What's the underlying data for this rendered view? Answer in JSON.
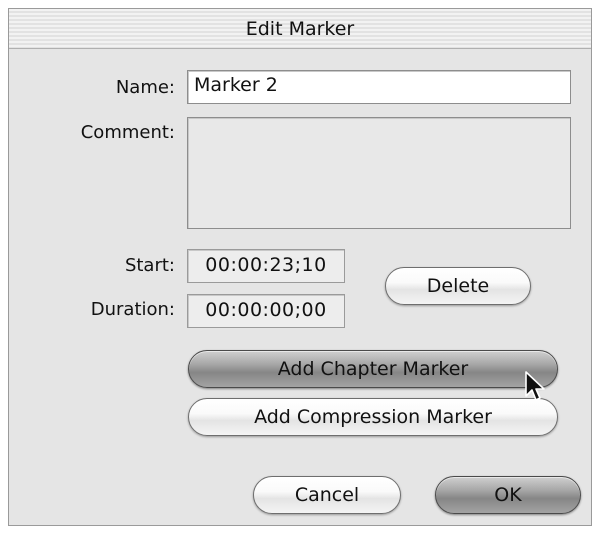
{
  "dialog": {
    "title": "Edit Marker",
    "name_label": "Name:",
    "name_value": "Marker 2",
    "comment_label": "Comment:",
    "comment_value": "",
    "start_label": "Start:",
    "start_value": "00:00:23;10",
    "duration_label": "Duration:",
    "duration_value": "00:00:00;00",
    "delete_label": "Delete",
    "add_chapter_label": "Add Chapter Marker",
    "add_compression_label": "Add Compression Marker",
    "cancel_label": "Cancel",
    "ok_label": "OK"
  },
  "icons": {
    "cursor": "arrow-pointer-icon"
  }
}
